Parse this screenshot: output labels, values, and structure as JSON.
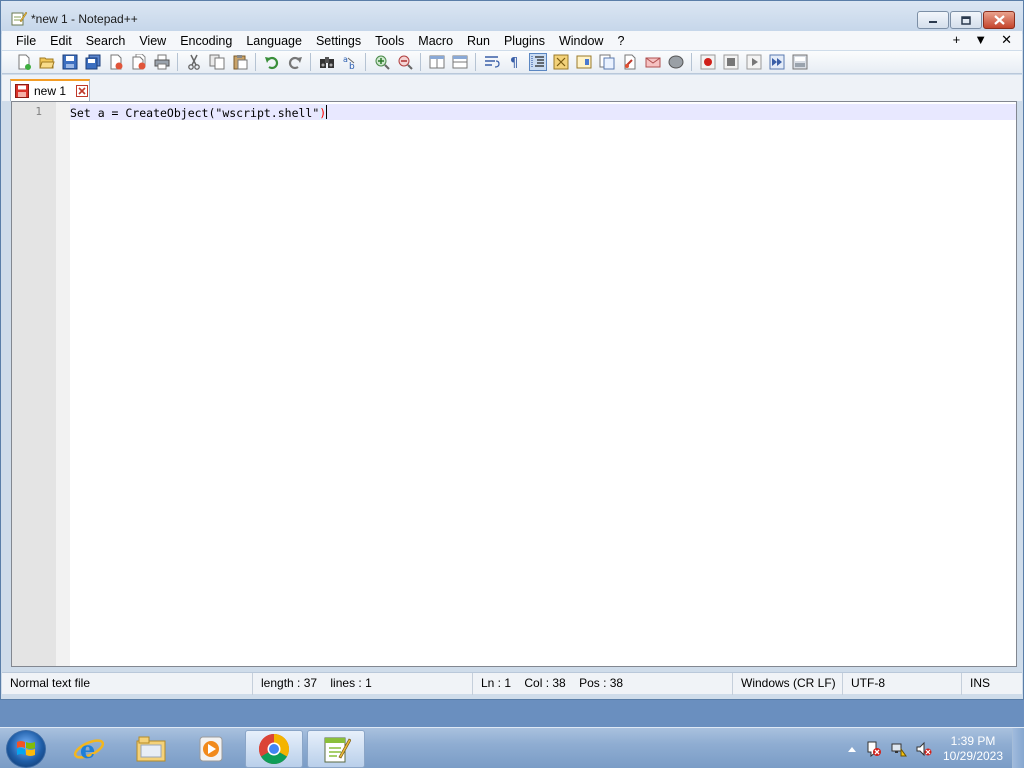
{
  "window": {
    "title": "*new 1 - Notepad++"
  },
  "menu": {
    "items": [
      "File",
      "Edit",
      "Search",
      "View",
      "Encoding",
      "Language",
      "Settings",
      "Tools",
      "Macro",
      "Run",
      "Plugins",
      "Window",
      "?"
    ],
    "right": [
      "+",
      "▼",
      "✕"
    ]
  },
  "toolbar": {
    "icons": [
      "new-file-icon",
      "open-file-icon",
      "save-icon",
      "save-all-icon",
      "close-icon",
      "close-all-icon",
      "print-icon",
      "|",
      "cut-icon",
      "copy-icon",
      "paste-icon",
      "|",
      "undo-icon",
      "redo-icon",
      "|",
      "find-icon",
      "replace-icon",
      "|",
      "zoom-in-icon",
      "zoom-out-icon",
      "|",
      "sync-vertical-icon",
      "sync-horizontal-icon",
      "|",
      "word-wrap-icon",
      "show-all-chars-icon",
      "indent-guide-icon",
      "user-defined-lang-icon",
      "doc-map-icon",
      "function-list-icon",
      "folder-as-workspace-icon",
      "monitoring-icon",
      "doc-switcher-icon",
      "|",
      "record-macro-icon",
      "stop-recording-icon",
      "play-macro-icon",
      "run-macro-multiple-icon",
      "save-macro-icon"
    ]
  },
  "tab": {
    "label": "new 1"
  },
  "editor": {
    "line_number": "1",
    "code_before": "Set a = CreateObject(",
    "code_string": "\"wscript.shell\"",
    "code_close": ")"
  },
  "status": {
    "file_type": "Normal text file",
    "length": "length : 37",
    "lines": "lines : 1",
    "ln": "Ln : 1",
    "col": "Col : 38",
    "pos": "Pos : 38",
    "eol": "Windows (CR LF)",
    "encoding": "UTF-8",
    "mode": "INS"
  },
  "taskbar": {
    "time": "1:39 PM",
    "date": "10/29/2023"
  }
}
